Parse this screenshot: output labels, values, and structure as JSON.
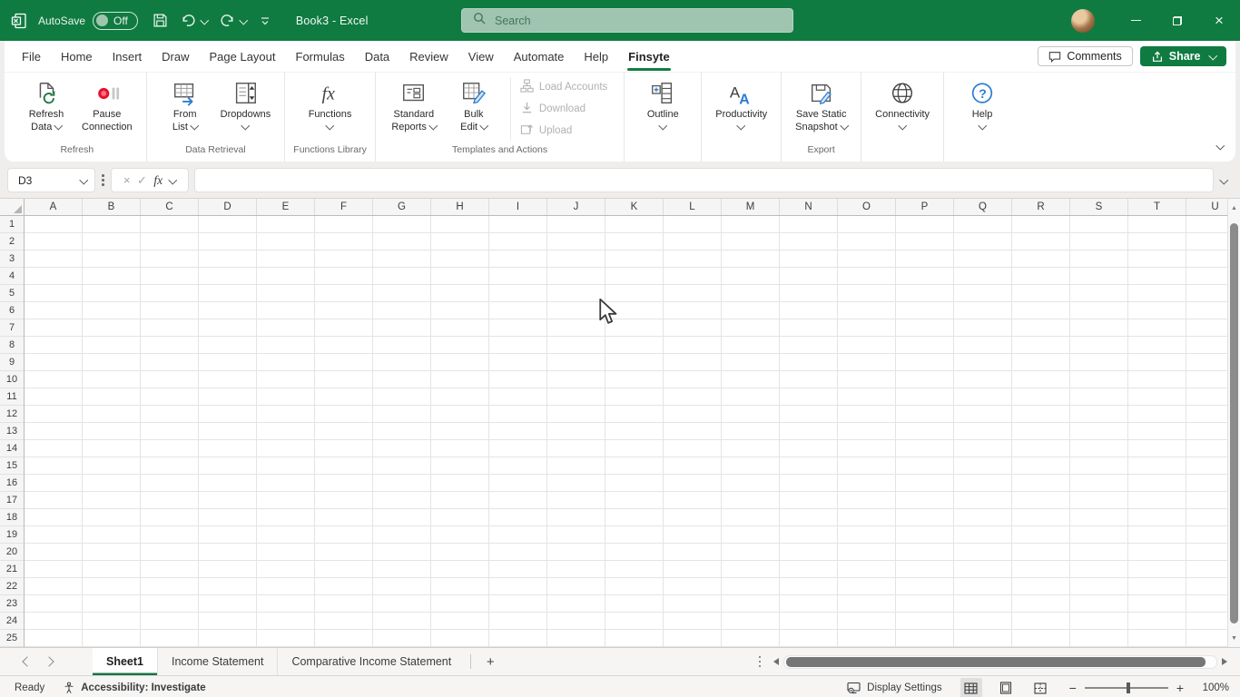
{
  "titlebar": {
    "autosave_label": "AutoSave",
    "autosave_state": "Off",
    "document_title": "Book3 - Excel",
    "search_placeholder": "Search"
  },
  "menu": {
    "tabs": [
      {
        "label": "File",
        "active": false
      },
      {
        "label": "Home",
        "active": false
      },
      {
        "label": "Insert",
        "active": false
      },
      {
        "label": "Draw",
        "active": false
      },
      {
        "label": "Page Layout",
        "active": false
      },
      {
        "label": "Formulas",
        "active": false
      },
      {
        "label": "Data",
        "active": false
      },
      {
        "label": "Review",
        "active": false
      },
      {
        "label": "View",
        "active": false
      },
      {
        "label": "Automate",
        "active": false
      },
      {
        "label": "Help",
        "active": false
      },
      {
        "label": "Finsyte",
        "active": true
      }
    ],
    "comments_label": "Comments",
    "share_label": "Share"
  },
  "ribbon": {
    "groups": [
      {
        "label": "Refresh",
        "buttons": [
          {
            "name": "refresh-data",
            "lines": [
              "Refresh",
              "Data"
            ],
            "dropdown": true,
            "disabled": false
          },
          {
            "name": "pause-connection",
            "lines": [
              "Pause",
              "Connection"
            ],
            "dropdown": false,
            "disabled": false
          }
        ]
      },
      {
        "label": "Data Retrieval",
        "buttons": [
          {
            "name": "from-list",
            "lines": [
              "From",
              "List"
            ],
            "dropdown": true,
            "disabled": false
          },
          {
            "name": "dropdowns",
            "lines": [
              "Dropdowns"
            ],
            "dropdown": true,
            "disabled": false
          }
        ]
      },
      {
        "label": "Functions Library",
        "buttons": [
          {
            "name": "functions",
            "lines": [
              "Functions"
            ],
            "dropdown": true,
            "disabled": false
          }
        ]
      },
      {
        "label": "Templates and Actions",
        "buttons": [
          {
            "name": "standard-reports",
            "lines": [
              "Standard",
              "Reports"
            ],
            "dropdown": true,
            "disabled": false
          },
          {
            "name": "bulk-edit",
            "lines": [
              "Bulk",
              "Edit"
            ],
            "dropdown": true,
            "disabled": false
          }
        ],
        "small_buttons": [
          {
            "name": "load-accounts",
            "label": "Load Accounts",
            "disabled": true
          },
          {
            "name": "download",
            "label": "Download",
            "disabled": true
          },
          {
            "name": "upload",
            "label": "Upload",
            "disabled": true
          }
        ]
      },
      {
        "label": "",
        "buttons": [
          {
            "name": "outline",
            "lines": [
              "Outline"
            ],
            "dropdown": true,
            "disabled": false
          }
        ]
      },
      {
        "label": "",
        "buttons": [
          {
            "name": "productivity",
            "lines": [
              "Productivity"
            ],
            "dropdown": true,
            "disabled": false
          }
        ]
      },
      {
        "label": "Export",
        "buttons": [
          {
            "name": "save-static-snapshot",
            "lines": [
              "Save Static",
              "Snapshot"
            ],
            "dropdown": true,
            "disabled": false
          }
        ]
      },
      {
        "label": "",
        "buttons": [
          {
            "name": "connectivity",
            "lines": [
              "Connectivity"
            ],
            "dropdown": true,
            "disabled": false
          }
        ]
      },
      {
        "label": "",
        "buttons": [
          {
            "name": "help",
            "lines": [
              "Help"
            ],
            "dropdown": true,
            "disabled": false
          }
        ]
      }
    ]
  },
  "formula_bar": {
    "name_box_value": "D3",
    "fx_label": "fx",
    "formula_value": ""
  },
  "grid": {
    "columns": [
      "A",
      "B",
      "C",
      "D",
      "E",
      "F",
      "G",
      "H",
      "I",
      "J",
      "K",
      "L",
      "M",
      "N",
      "O",
      "P",
      "Q",
      "R",
      "S",
      "T",
      "U"
    ],
    "rows": [
      1,
      2,
      3,
      4,
      5,
      6,
      7,
      8,
      9,
      10,
      11,
      12,
      13,
      14,
      15,
      16,
      17,
      18,
      19,
      20,
      21,
      22,
      23,
      24,
      25
    ]
  },
  "sheet_bar": {
    "tabs": [
      {
        "label": "Sheet1",
        "active": true
      },
      {
        "label": "Income Statement",
        "active": false
      },
      {
        "label": "Comparative Income Statement",
        "active": false
      }
    ]
  },
  "status_bar": {
    "ready_label": "Ready",
    "accessibility_label": "Accessibility: Investigate",
    "display_settings_label": "Display Settings",
    "zoom_level": "100%"
  },
  "icons": {
    "cancel": "×",
    "enter": "✓",
    "add_sheet": "+",
    "scroll_up": "▲",
    "scroll_down": "▼",
    "zoom_out": "−",
    "zoom_in": "+"
  },
  "colors": {
    "titlebar_green": "#0f7b41",
    "accent_green": "#127c42",
    "share_green": "#0f7b41",
    "disabled_text": "#b3b1af"
  }
}
